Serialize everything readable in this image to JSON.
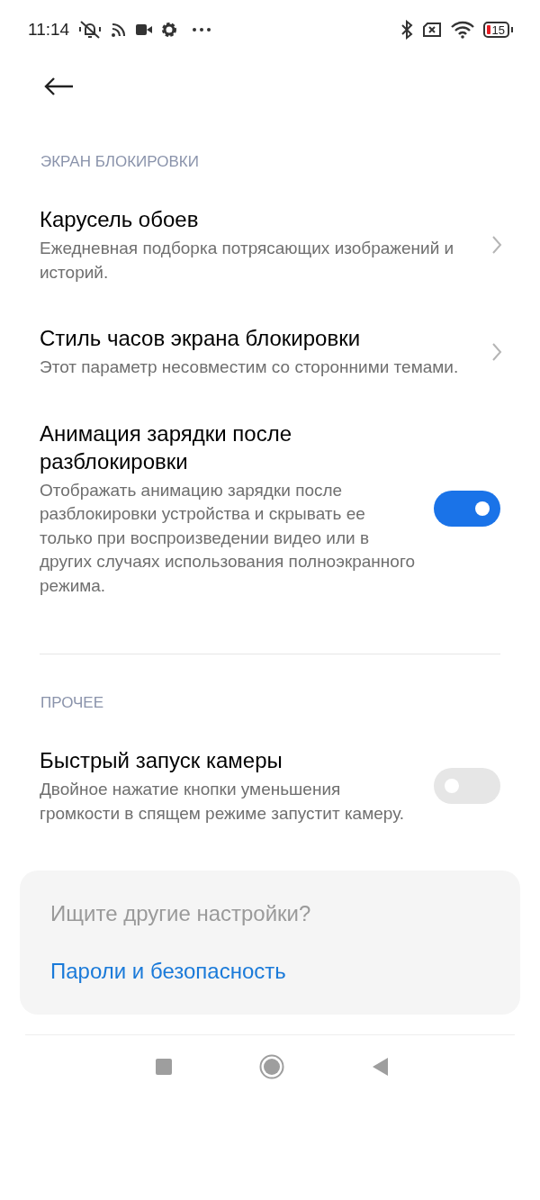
{
  "status_bar": {
    "time": "11:14",
    "battery": "15"
  },
  "sections": [
    {
      "header": "ЭКРАН БЛОКИРОВКИ",
      "items": [
        {
          "kind": "link",
          "title": "Карусель обоев",
          "description": "Ежедневная подборка потрясающих изображений и историй."
        },
        {
          "kind": "link",
          "title": "Стиль часов экрана блокировки",
          "description": "Этот параметр несовместим со сторонними темами."
        },
        {
          "kind": "toggle",
          "title": "Анимация зарядки после разблокировки",
          "description": "Отображать анимацию зарядки после разблокировки устройства и скрывать ее только при воспроизведении видео или в других случаях использования полноэкранного режима.",
          "on": true
        }
      ]
    },
    {
      "header": "ПРОЧЕЕ",
      "items": [
        {
          "kind": "toggle",
          "title": "Быстрый запуск камеры",
          "description": "Двойное нажатие кнопки уменьшения громкости в спящем режиме запустит камеру.",
          "on": false
        }
      ]
    }
  ],
  "more_card": {
    "title": "Ищите другие настройки?",
    "link": "Пароли и безопасность"
  }
}
